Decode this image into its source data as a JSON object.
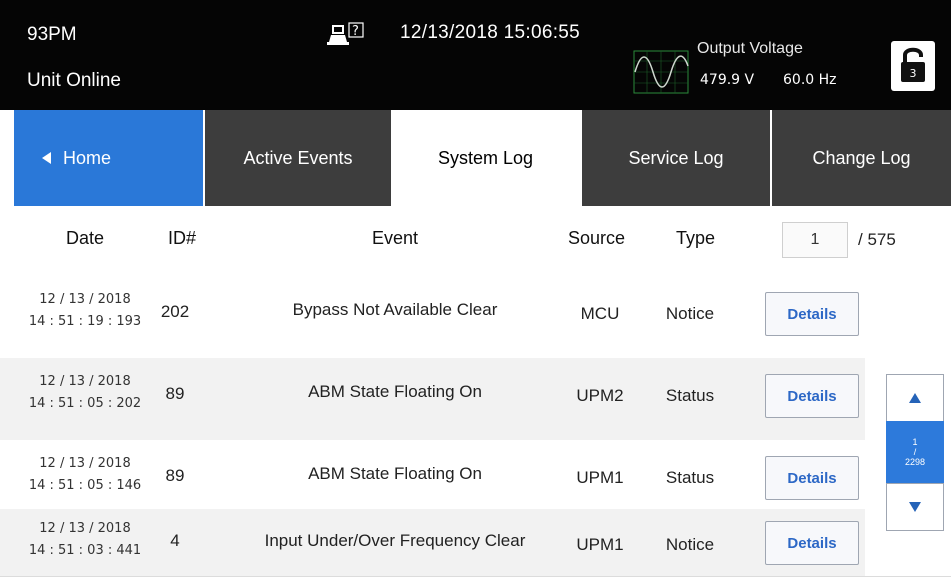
{
  "header": {
    "model": "93PM",
    "unit_status": "Unit Online",
    "datetime": "12/13/2018 15:06:55",
    "output_label": "Output Voltage",
    "output_voltage": "479.9 V",
    "output_frequency": "60.0 Hz",
    "help_icon": "help-screen-icon",
    "wave_icon": "sine-wave-icon",
    "lock_icon": "unlocked-padlock-icon",
    "lock_level": "3"
  },
  "tabs": [
    {
      "label": "Home",
      "state": "nav"
    },
    {
      "label": "Active Events",
      "state": "inactive"
    },
    {
      "label": "System Log",
      "state": "active"
    },
    {
      "label": "Service Log",
      "state": "inactive"
    },
    {
      "label": "Change Log",
      "state": "inactive"
    }
  ],
  "columns": {
    "date": "Date",
    "id": "ID#",
    "event": "Event",
    "source": "Source",
    "type": "Type"
  },
  "pagination": {
    "page": "1",
    "total": "/ 575"
  },
  "rows": [
    {
      "date": "12 / 13 / 2018",
      "time": "14 : 51 : 19 : 193",
      "id": "202",
      "event": "Bypass Not Available Clear",
      "source": "MCU",
      "type": "Notice",
      "details": "Details"
    },
    {
      "date": "12 / 13 / 2018",
      "time": "14 : 51 : 05 : 202",
      "id": "89",
      "event": "ABM State Floating On",
      "source": "UPM2",
      "type": "Status",
      "details": "Details"
    },
    {
      "date": "12 / 13 / 2018",
      "time": "14 : 51 : 05 : 146",
      "id": "89",
      "event": "ABM State Floating On",
      "source": "UPM1",
      "type": "Status",
      "details": "Details"
    },
    {
      "date": "12 / 13 / 2018",
      "time": "14 : 51 : 03 : 441",
      "id": "4",
      "event": "Input Under/Over Frequency Clear",
      "source": "UPM1",
      "type": "Notice",
      "details": "Details"
    }
  ],
  "scroller": {
    "position": "1",
    "separator": "/",
    "total": "2298"
  },
  "colors": {
    "header_bg": "#050505",
    "home_tab": "#2a78d8",
    "inactive_tab": "#3d3d3d",
    "details_text": "#2d68c6",
    "scroll_thumb": "#2d7adb"
  }
}
